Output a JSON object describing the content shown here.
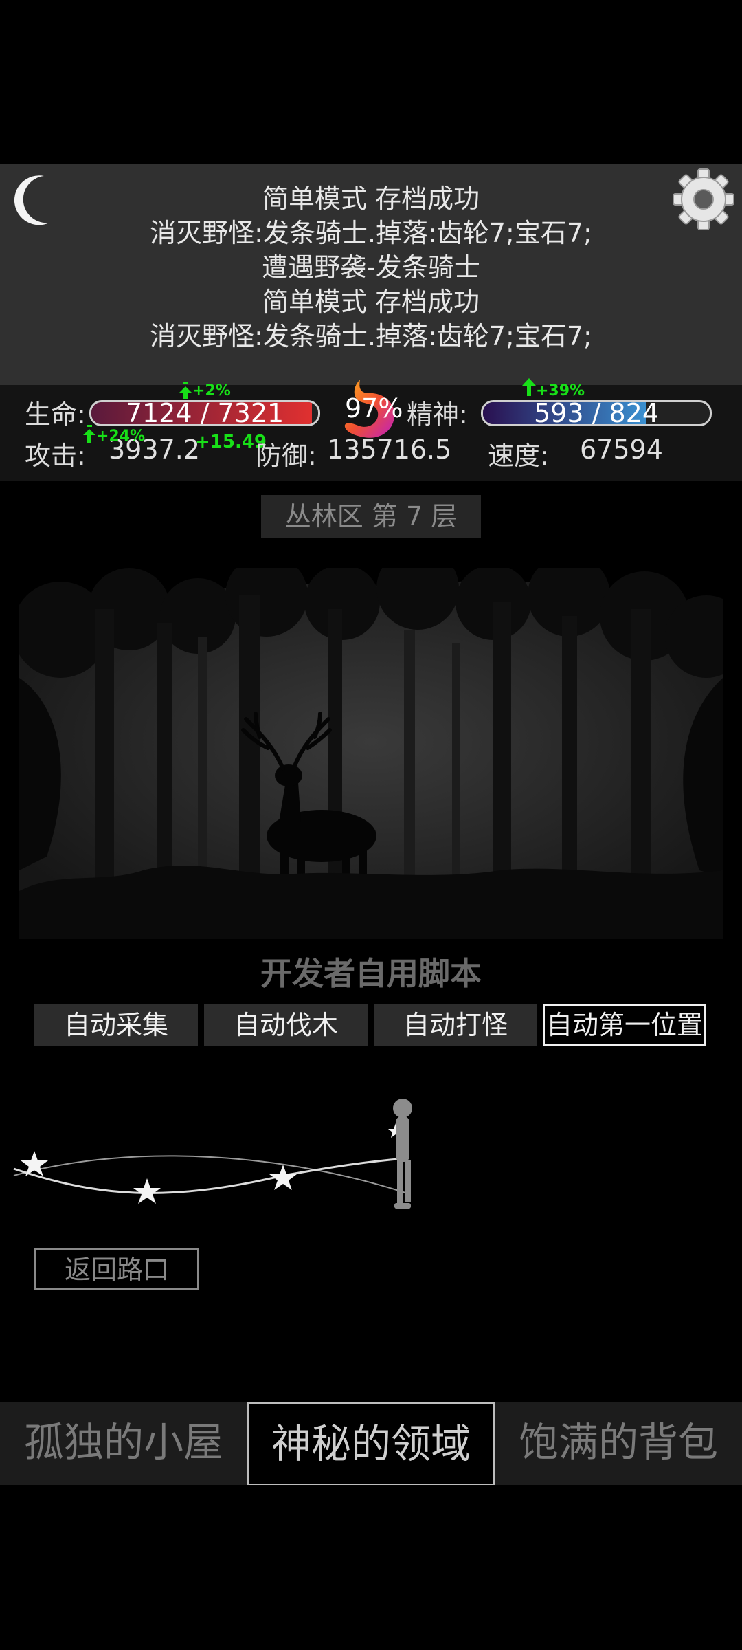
{
  "log": [
    "简单模式 存档成功",
    "消灭野怪:发条骑士.掉落:齿轮7;宝石7;",
    "遭遇野袭-发条骑士",
    "简单模式 存档成功",
    "消灭野怪:发条骑士.掉落:齿轮7;宝石7;"
  ],
  "stats": {
    "hp_label": "生命:",
    "hp_text": "7124 / 7321",
    "hp_value": 7124,
    "hp_max": 7321,
    "hp_buff": "+2%",
    "hunger_text": "97%",
    "spirit_label": "精神:",
    "spirit_text": "593 / 824",
    "spirit_value": 593,
    "spirit_max": 824,
    "spirit_buff": "+39%",
    "attack_label": "攻击:",
    "attack_value": "3937.2",
    "attack_buff": "+24%",
    "attack_bonus": "+15.49",
    "defense_label": "防御:",
    "defense_value": "135716.5",
    "speed_label": "速度:",
    "speed_value": "67594"
  },
  "area": {
    "floor": "丛林区 第 7 层"
  },
  "script": {
    "title": "开发者自用脚本",
    "buttons": [
      "自动采集",
      "自动伐木",
      "自动打怪",
      "自动第一位置"
    ],
    "active_index": 3
  },
  "back_button": "返回路口",
  "tabs": [
    {
      "label": "孤独的小屋",
      "active": false
    },
    {
      "label": "神秘的领域",
      "active": true
    },
    {
      "label": "饱满的背包",
      "active": false
    }
  ],
  "colors": {
    "hp_fill_start": "#5a1a3c",
    "hp_fill_end": "#e03030",
    "spirit_fill_start": "#2a1050",
    "spirit_fill_end": "#3a90d0",
    "buff_green": "#18e018"
  },
  "icons": {
    "moon": "crescent-moon-icon",
    "gear": "gear-icon",
    "hunger": "stomach-icon",
    "buff_arrow": "up-arrow-icon"
  }
}
